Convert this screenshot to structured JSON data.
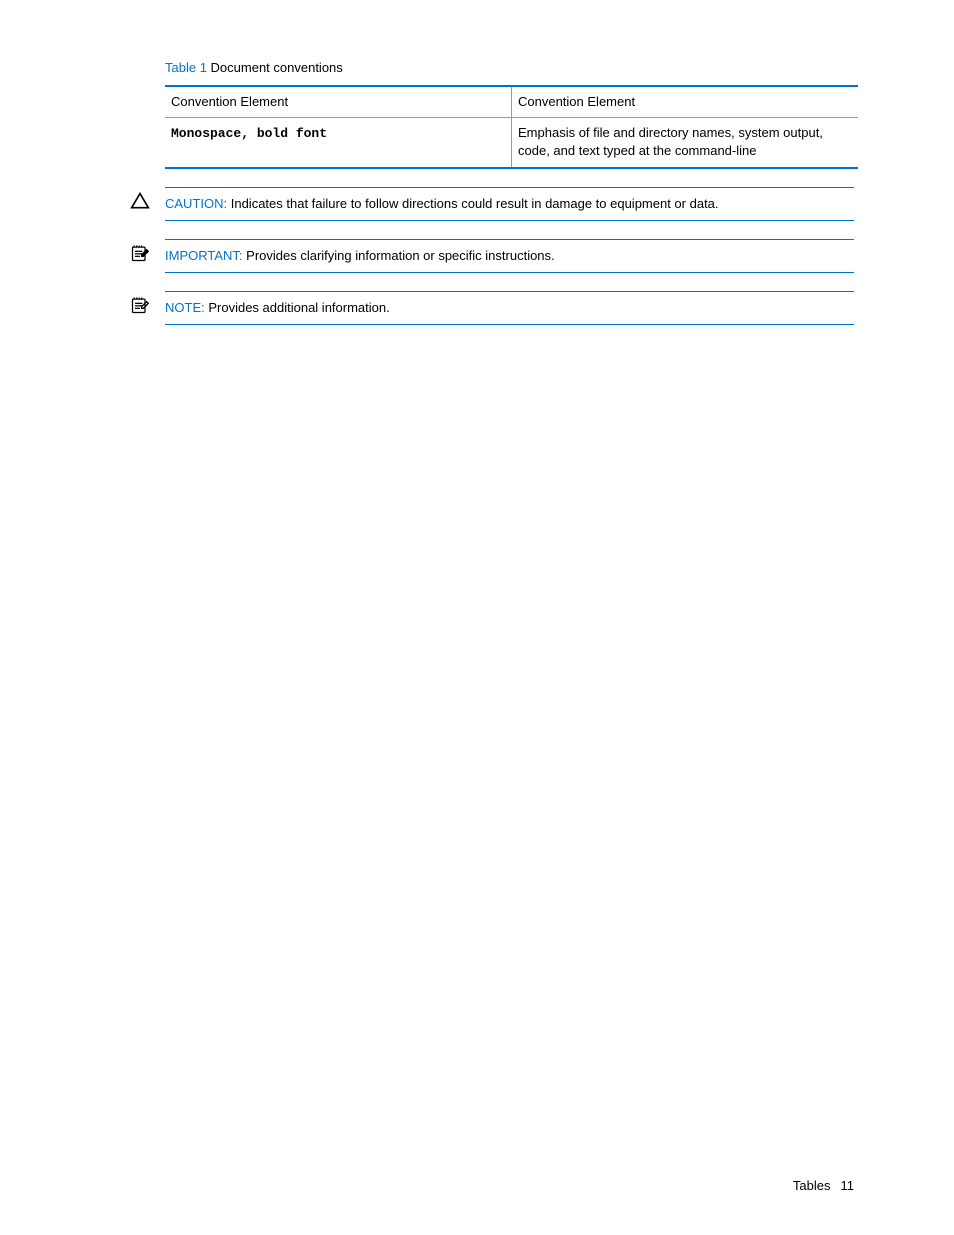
{
  "table": {
    "caption_link": "Table 1",
    "caption_text": " Document conventions",
    "header": {
      "col1": "Convention Element",
      "col2": "Convention Element"
    },
    "row1": {
      "col1": "Monospace, bold font",
      "col2": "Emphasis of file and directory names, system output, code, and text typed at the command-line"
    }
  },
  "notices": {
    "caution": {
      "label": "CAUTION:",
      "text": "  Indicates that failure to follow directions could result in damage to equipment or data."
    },
    "important": {
      "label": "IMPORTANT:",
      "text": "  Provides clarifying information or specific instructions."
    },
    "note": {
      "label": "NOTE:",
      "text": "  Provides additional information."
    }
  },
  "footer": {
    "section": "Tables",
    "page": "11"
  }
}
